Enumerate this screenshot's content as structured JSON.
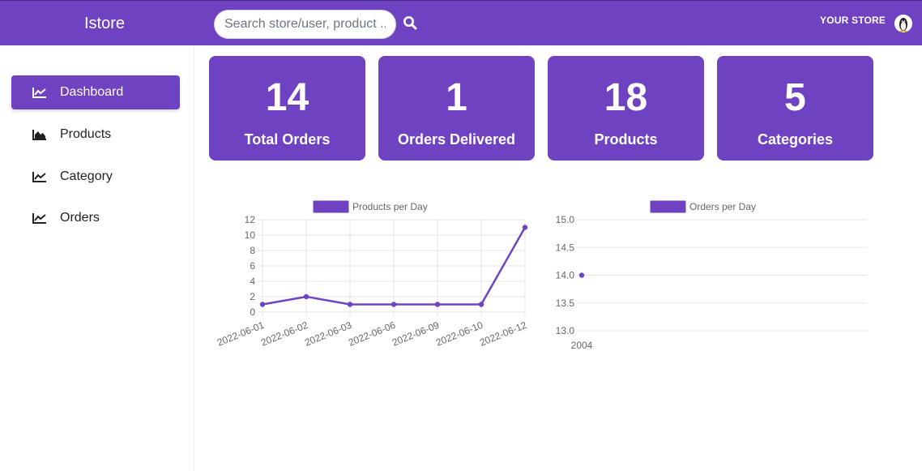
{
  "colors": {
    "brand": "#6f42c1",
    "grid": "#e6e6e6",
    "axis_text": "#666666"
  },
  "header": {
    "title": "Istore",
    "search": {
      "placeholder": "Search store/user, product ..",
      "value": ""
    },
    "search_icon": "search-icon",
    "store_label": "YOUR STORE",
    "avatar_icon": "penguin-avatar-icon"
  },
  "sidebar": {
    "items": [
      {
        "label": "Dashboard",
        "icon": "line-chart-icon",
        "active": true
      },
      {
        "label": "Products",
        "icon": "area-chart-icon",
        "active": false
      },
      {
        "label": "Category",
        "icon": "line-chart-icon",
        "active": false
      },
      {
        "label": "Orders",
        "icon": "line-chart-icon",
        "active": false
      }
    ]
  },
  "stats": [
    {
      "value": "14",
      "label": "Total Orders"
    },
    {
      "value": "1",
      "label": "Orders Delivered"
    },
    {
      "value": "18",
      "label": "Products"
    },
    {
      "value": "5",
      "label": "Categories"
    }
  ],
  "chart_data": [
    {
      "type": "line",
      "legend": "Products per Day",
      "legend_position": "top",
      "x": [
        "2022-06-01",
        "2022-06-02",
        "2022-06-03",
        "2022-06-06",
        "2022-06-09",
        "2022-06-10",
        "2022-06-12"
      ],
      "series": [
        {
          "name": "Products per Day",
          "values": [
            1,
            2,
            1,
            1,
            1,
            1,
            11
          ]
        }
      ],
      "ylim": [
        0,
        12
      ],
      "yticks": [
        "0",
        "2",
        "4",
        "6",
        "8",
        "10",
        "12"
      ],
      "grid": true
    },
    {
      "type": "line",
      "legend": "Orders per Day",
      "legend_position": "top",
      "x": [
        "2004"
      ],
      "series": [
        {
          "name": "Orders per Day",
          "values": [
            14
          ]
        }
      ],
      "ylim": [
        13,
        15
      ],
      "yticks": [
        "13.0",
        "13.5",
        "14.0",
        "14.5",
        "15.0"
      ],
      "grid": true
    }
  ]
}
